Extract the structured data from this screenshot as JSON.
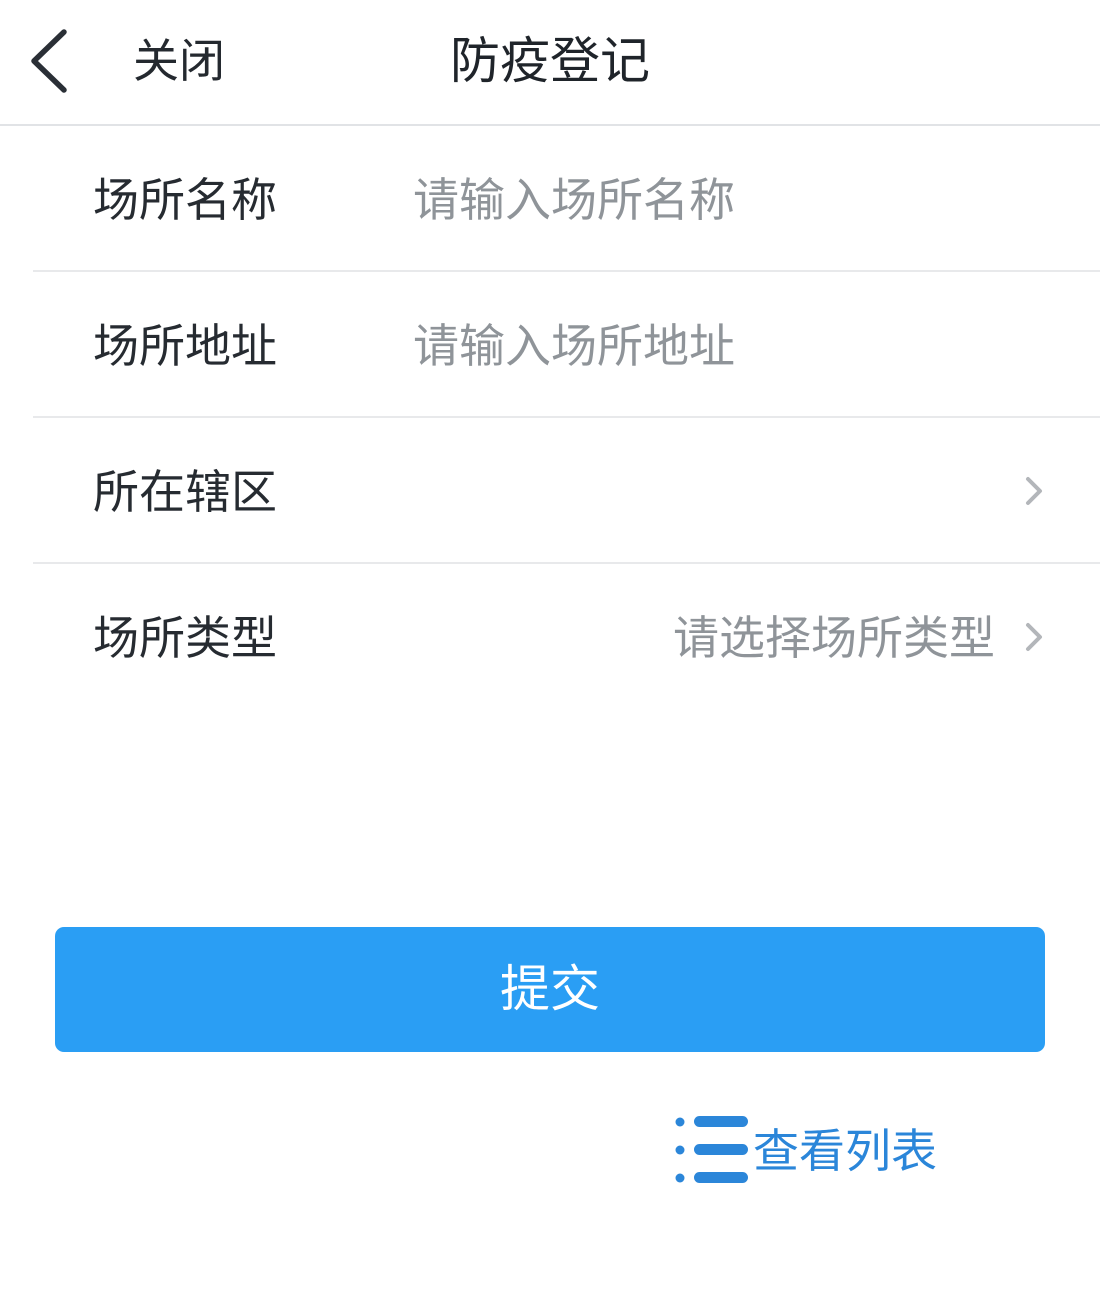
{
  "header": {
    "back_icon": "chevron-left-icon",
    "close_label": "关闭",
    "title": "防疫登记"
  },
  "form": {
    "rows": [
      {
        "label": "场所名称",
        "placeholder": "请输入场所名称",
        "value": ""
      },
      {
        "label": "场所地址",
        "placeholder": "请输入场所地址",
        "value": ""
      },
      {
        "label": "所在辖区",
        "value": "",
        "icon": "chevron-right-icon"
      },
      {
        "label": "场所类型",
        "value": "请选择场所类型",
        "icon": "chevron-right-icon"
      }
    ]
  },
  "actions": {
    "submit_label": "提交",
    "view_list_label": "查看列表",
    "view_list_icon": "list-icon"
  },
  "colors": {
    "primary": "#2a9ef4",
    "link": "#2b86d9",
    "placeholder": "#8f9499",
    "divider": "#e8e9eb"
  }
}
